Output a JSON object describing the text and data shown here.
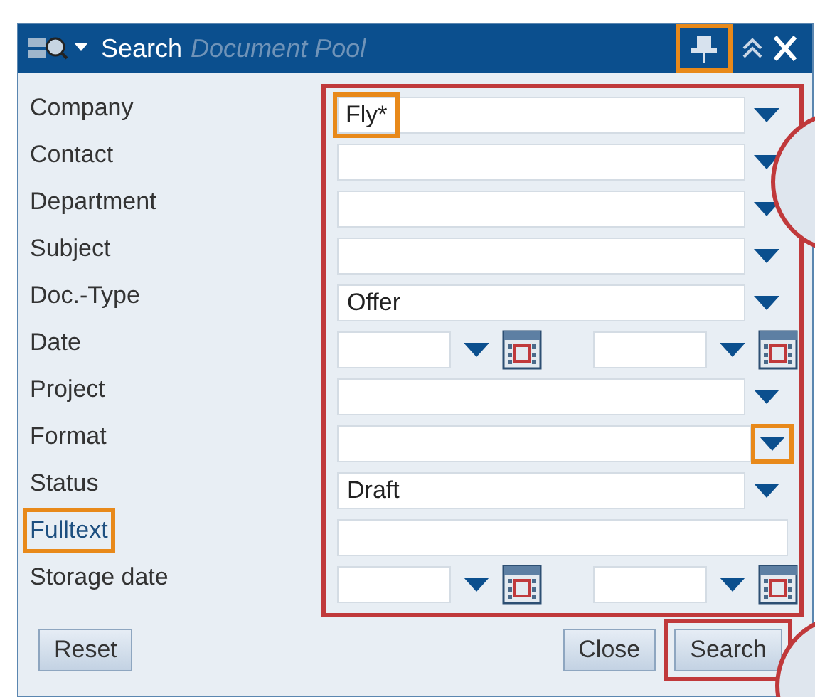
{
  "window": {
    "title": "Search",
    "subtitle": "Document Pool",
    "pin_highlighted": true
  },
  "fields": [
    {
      "label": "Company",
      "kind": "combo",
      "value": "Fly*",
      "value_highlighted": true
    },
    {
      "label": "Contact",
      "kind": "combo"
    },
    {
      "label": "Department",
      "kind": "combo"
    },
    {
      "label": "Subject",
      "kind": "combo"
    },
    {
      "label": "Doc.-Type",
      "kind": "combo",
      "value": "Offer"
    },
    {
      "label": "Date",
      "kind": "date_range"
    },
    {
      "label": "Project",
      "kind": "combo"
    },
    {
      "label": "Format",
      "kind": "combo",
      "arrow_highlighted": true
    },
    {
      "label": "Status",
      "kind": "combo",
      "value": "Draft"
    },
    {
      "label": "Fulltext",
      "kind": "text",
      "label_highlighted": true
    },
    {
      "label": "Storage date",
      "kind": "date_range"
    }
  ],
  "buttons": [
    {
      "label": "Reset",
      "highlighted": false
    },
    {
      "label": "Close",
      "highlighted": false
    },
    {
      "label": "Search",
      "highlighted": true
    }
  ]
}
